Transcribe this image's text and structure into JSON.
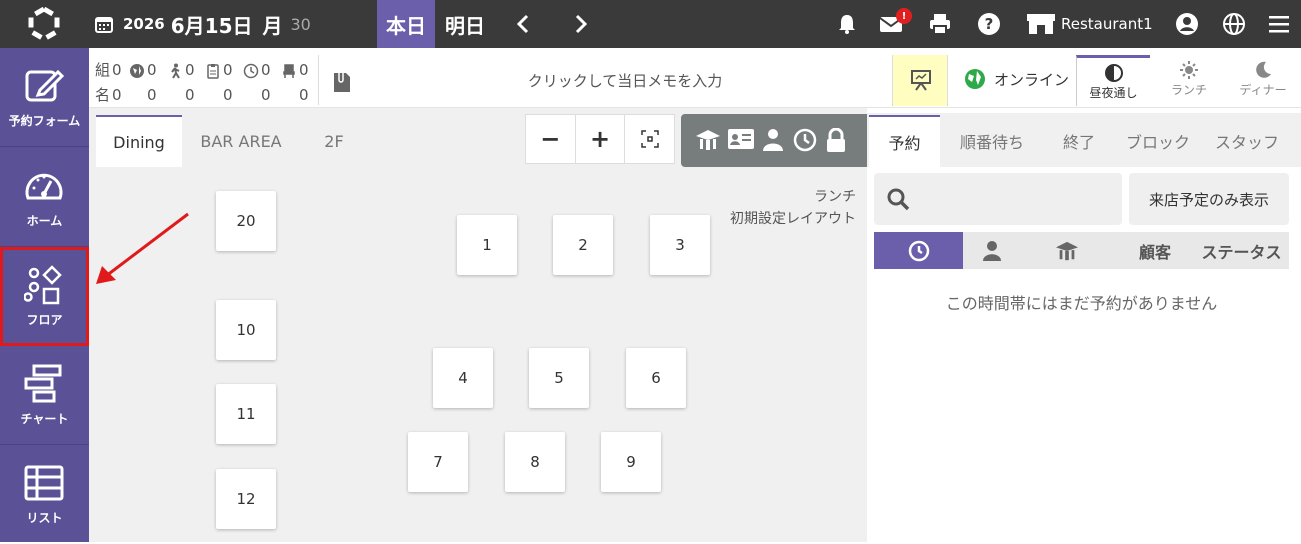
{
  "topbar": {
    "year": "2026",
    "month_day": "6月15日",
    "weekday": "月",
    "count": "30",
    "today_label": "本日",
    "tomorrow_label": "明日",
    "mail_badge": "!",
    "restaurant": "Restaurant1"
  },
  "sidebar": {
    "items": [
      {
        "label": "予約フォーム",
        "icon": "edit-icon"
      },
      {
        "label": "ホーム",
        "icon": "dashboard-icon"
      },
      {
        "label": "フロア",
        "icon": "floor-icon",
        "active": true
      },
      {
        "label": "チャート",
        "icon": "chart-icon"
      },
      {
        "label": "リスト",
        "icon": "list-icon"
      }
    ]
  },
  "stats": {
    "groups_label": "組",
    "people_label": "名",
    "groups": [
      "0",
      "0",
      "0",
      "0",
      "0",
      "0"
    ],
    "people": [
      "0",
      "0",
      "0",
      "0",
      "0",
      "0"
    ]
  },
  "memo": {
    "placeholder": "クリックして当日メモを入力"
  },
  "online": {
    "label": "オンライン"
  },
  "meal_filter": {
    "options": [
      "昼夜通し",
      "ランチ",
      "ディナー"
    ],
    "selected": "昼夜通し"
  },
  "floor": {
    "tabs": [
      "Dining",
      "BAR AREA",
      "2F"
    ],
    "active_tab": "Dining",
    "zoom_minus": "−",
    "zoom_plus": "+",
    "layout_line1": "ランチ",
    "layout_line2": "初期設定レイアウト",
    "tables": [
      "20",
      "10",
      "11",
      "12",
      "1",
      "2",
      "3",
      "4",
      "5",
      "6",
      "7",
      "8",
      "9"
    ]
  },
  "panel": {
    "tabs": [
      "予約",
      "順番待ち",
      "終了",
      "ブロック",
      "スタッフ"
    ],
    "active_tab": "予約",
    "visit_only_label": "来店予定のみ表示",
    "columns": {
      "customer": "顧客",
      "status": "ステータス"
    },
    "empty_message": "この時間帯にはまだ予約がありません"
  },
  "colors": {
    "topbar": "#3a3a3a",
    "sidebar": "#5a5196",
    "accent": "#6b5eaa",
    "highlight": "#e01a1a"
  }
}
